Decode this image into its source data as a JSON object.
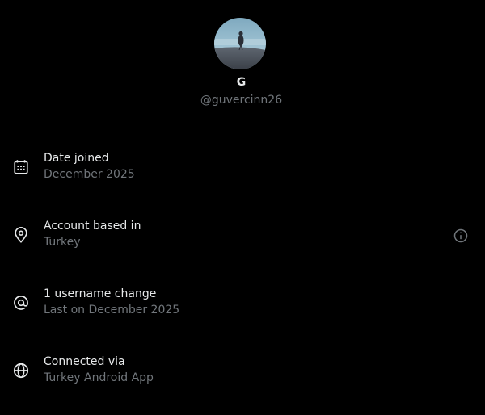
{
  "profile": {
    "display_name": "G",
    "handle": "@guvercinn26",
    "avatar_icon": "pigeon-photo-avatar"
  },
  "about": [
    {
      "icon": "calendar-icon",
      "label": "Date joined",
      "value": "December 2025"
    },
    {
      "icon": "location-pin-icon",
      "label": "Account based in",
      "value": "Turkey",
      "info_icon": "info-icon"
    },
    {
      "icon": "at-sign-icon",
      "label": "1 username change",
      "value": "Last on December 2025"
    },
    {
      "icon": "globe-icon",
      "label": "Connected via",
      "value": "Turkey Android App"
    }
  ],
  "colors": {
    "background": "#000000",
    "primary_text": "#e7e9ea",
    "secondary_text": "#71767b"
  }
}
